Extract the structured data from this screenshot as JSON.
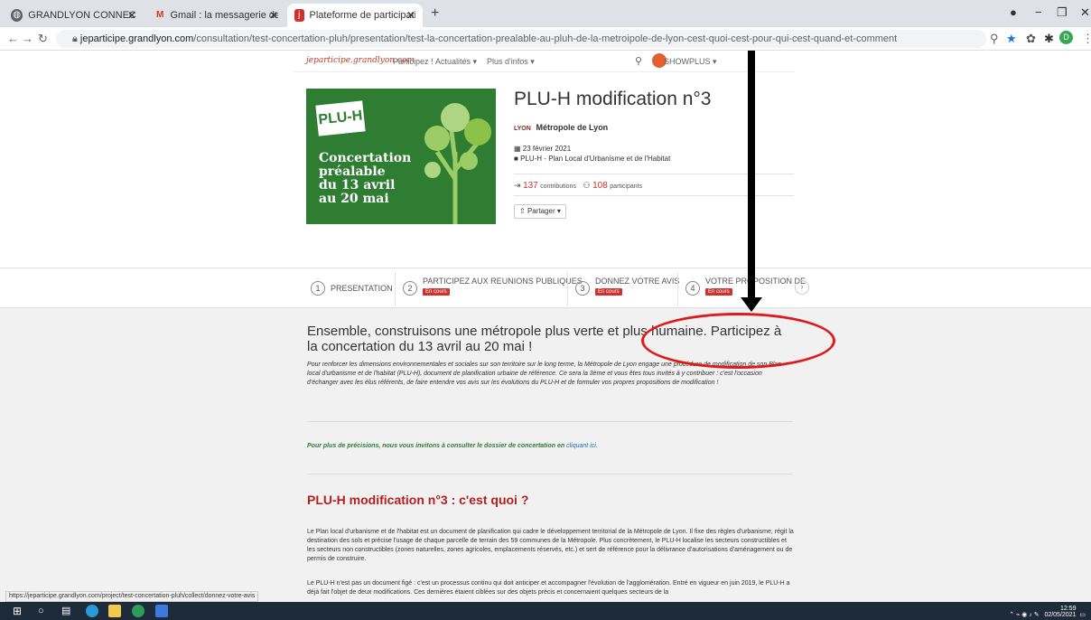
{
  "browser": {
    "tabs": [
      {
        "title": "GRANDLYON CONNECT",
        "icon": "globe-icon"
      },
      {
        "title": "Gmail : la messagerie de Google",
        "icon": "gmail-icon"
      },
      {
        "title": "Plateforme de participation citoy",
        "icon": "jeparticipe-icon",
        "active": true
      }
    ],
    "new_tab": "+",
    "url_host": "jeparticipe.grandlyon.com",
    "url_path": "/consultation/test-concertation-pluh/presentation/test-la-concertation-prealable-au-pluh-de-la-metroipole-de-lyon-cest-quoi-cest-pour-qui-cest-quand-et-comment",
    "profile_letter": "D"
  },
  "site": {
    "logo": "jeparticipe.grandlyon.com",
    "nav": [
      "Participez !",
      "Actualités ▾",
      "Plus d'infos ▾"
    ],
    "user": "SHOWPLUS ▾"
  },
  "hero": {
    "box": "PLU-H",
    "text": "Concertation\npréalable\ndu 13 avril\nau 20 mai"
  },
  "project": {
    "title": "PLU-H modification n°3",
    "org_logo": "LYON",
    "org": "Métropole de Lyon",
    "date": "23 février 2021",
    "theme": "PLU-H - Plan Local d'Urbanisme et de l'Habitat",
    "contributions_count": "137",
    "contributions_label": "contributions",
    "participants_count": "108",
    "participants_label": "participants",
    "share": "Partager ▾"
  },
  "steps": [
    {
      "num": "1",
      "label": "PRESENTATION",
      "badge": ""
    },
    {
      "num": "2",
      "label": "PARTICIPEZ AUX REUNIONS PUBLIQUES",
      "badge": "En cours"
    },
    {
      "num": "3",
      "label": "DONNEZ VOTRE AVIS",
      "badge": "En cours"
    },
    {
      "num": "4",
      "label": "VOTRE PROPOSITION DE",
      "badge": "En cours"
    }
  ],
  "intro": {
    "heading": "Ensemble, construisons une métropole plus verte et plus humaine. Participez à la concertation du 13 avril au 20 mai !",
    "paragraph": "Pour renforcer les dimensions environnementales et sociales sur son territoire sur le long terme, la Métropole de Lyon engage une procédure de modification de son Plan local d'urbanisme et de l'habitat (PLU-H), document de planification urbaine de référence. Ce sera la 3ème et vous êtes tous invités à y contribuer : c'est l'occasion d'échanger avec les élus référents, de faire entendre vos avis sur les évolutions du PLU-H et de formuler vos propres propositions de modification !",
    "more": "Pour plus de précisions, nous vous invitons à consulter le dossier de concertation en",
    "more_link": "cliquant ici."
  },
  "section": {
    "heading": "PLU-H modification n°3 : c'est quoi ?",
    "p1": "Le Plan local d'urbanisme et de l'habitat est un document de planification qui cadre le développement territorial de la Métropole de Lyon. Il fixe des règles d'urbanisme, régit la destination des sols et précise l'usage de chaque parcelle de terrain des 59 communes de la Métropole. Plus concrètement, le PLU-H localise les secteurs constructibles et les secteurs non constructibles (zones naturelles, zones agricoles, emplacements réservés, etc.) et sert de référence pour la délivrance d'autorisations d'aménagement ou de permis de construire.",
    "p2": "Le PLU-H n'est pas un document figé : c'est un processus continu qui doit anticiper et accompagner l'évolution de l'agglomération. Entré en vigueur en juin 2019, le PLU-H a déjà fait l'objet de deux modifications. Ces dernières étaient ciblées sur des objets précis et concernaient quelques secteurs de la"
  },
  "status_url": "https://jeparticipe.grandlyon.com/project/test-concertation-pluh/collect/donnez-votre-avis",
  "taskbar": {
    "time": "12:59",
    "date": "02/05/2021"
  },
  "colors": {
    "accent_red": "#d0312d",
    "hero_green": "#2e7d32",
    "annotation_red": "#e0191b"
  }
}
